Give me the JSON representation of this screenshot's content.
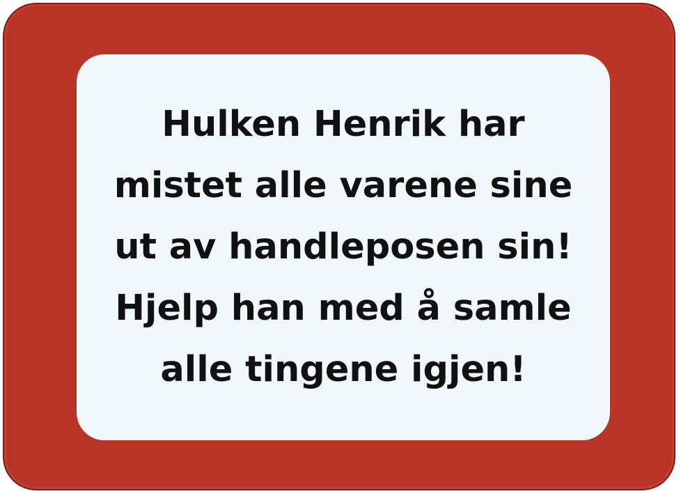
{
  "colors": {
    "frame": "#b83427",
    "panel": "#f0f8fc",
    "text": "#111111"
  },
  "dialog": {
    "lines": [
      "Hulken Henrik har",
      "mistet alle varene sine",
      "ut av handleposen sin!",
      "Hjelp han med å samle",
      "alle tingene igjen!"
    ]
  }
}
